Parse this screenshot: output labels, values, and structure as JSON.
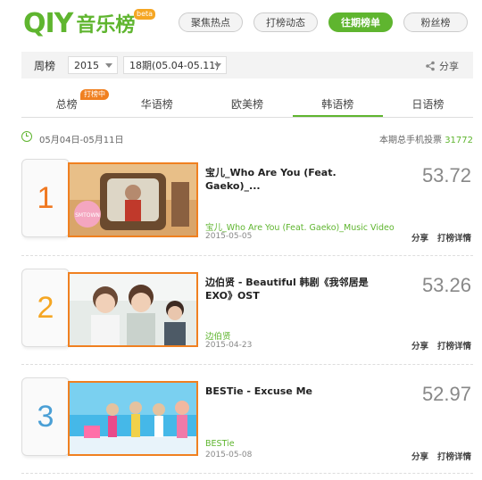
{
  "header": {
    "logo_mark": "QIY",
    "logo_text": "音乐榜",
    "logo_badge": "beta",
    "nav": [
      {
        "label": "聚焦热点",
        "active": false
      },
      {
        "label": "打榜动态",
        "active": false
      },
      {
        "label": "往期榜单",
        "active": true
      },
      {
        "label": "粉丝榜",
        "active": false
      }
    ]
  },
  "filter": {
    "label": "周榜",
    "year": "2015",
    "period": "18期(05.04-05.11)",
    "share": "分享"
  },
  "tabs": [
    {
      "label": "总榜",
      "badge": "打榜中",
      "active": false
    },
    {
      "label": "华语榜",
      "active": false
    },
    {
      "label": "欧美榜",
      "active": false
    },
    {
      "label": "韩语榜",
      "active": true
    },
    {
      "label": "日语榜",
      "active": false
    }
  ],
  "info": {
    "date_range": "05月04日-05月11日",
    "votes_label": "本期总手机投票",
    "votes_value": "31772"
  },
  "entries": [
    {
      "rank": "1",
      "rank_color": "#f07820",
      "title": "宝儿_Who Are You (Feat. Gaeko)_...",
      "artist": "宝儿_Who Are You (Feat. Gaeko)_Music Video",
      "date": "2015-05-05",
      "score": "53.72",
      "share": "分享",
      "detail": "打榜详情"
    },
    {
      "rank": "2",
      "rank_color": "#f5a623",
      "title": "边伯贤 - Beautiful 韩剧《我邻居是EXO》OST",
      "artist": "边伯贤",
      "date": "2015-04-23",
      "score": "53.26",
      "share": "分享",
      "detail": "打榜详情"
    },
    {
      "rank": "3",
      "rank_color": "#4a9fd5",
      "title": "BESTie - Excuse Me",
      "artist": "BESTie",
      "date": "2015-05-08",
      "score": "52.97",
      "share": "分享",
      "detail": "打榜详情"
    }
  ]
}
